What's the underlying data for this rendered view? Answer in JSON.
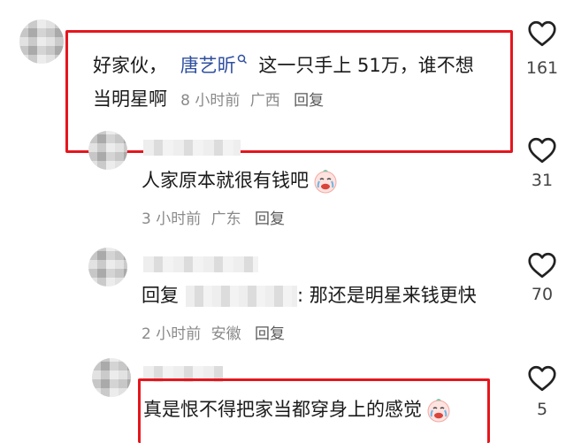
{
  "comments": [
    {
      "text_prefix": "好家伙，",
      "mention": "唐艺昕",
      "mention_icon": "search-icon",
      "text_rest_line1": "这一只手上 51万，谁不想",
      "text_line2": "当明星啊",
      "time": "8 小时前",
      "location": "广西",
      "reply": "回复",
      "likes": "161"
    },
    {
      "text": "人家原本就很有钱吧",
      "emoji": "crying-laughing-face",
      "time": "3 小时前",
      "location": "广东",
      "reply": "回复",
      "likes": "31"
    },
    {
      "reply_prefix": "回复",
      "text": ": 那还是明星来钱更快",
      "time": "2 小时前",
      "location": "安徽",
      "reply": "回复",
      "likes": "70"
    },
    {
      "text": "真是恨不得把家当都穿身上的感觉",
      "emoji": "crying-laughing-face",
      "likes": "5"
    }
  ],
  "highlight_color": "#e5161d"
}
